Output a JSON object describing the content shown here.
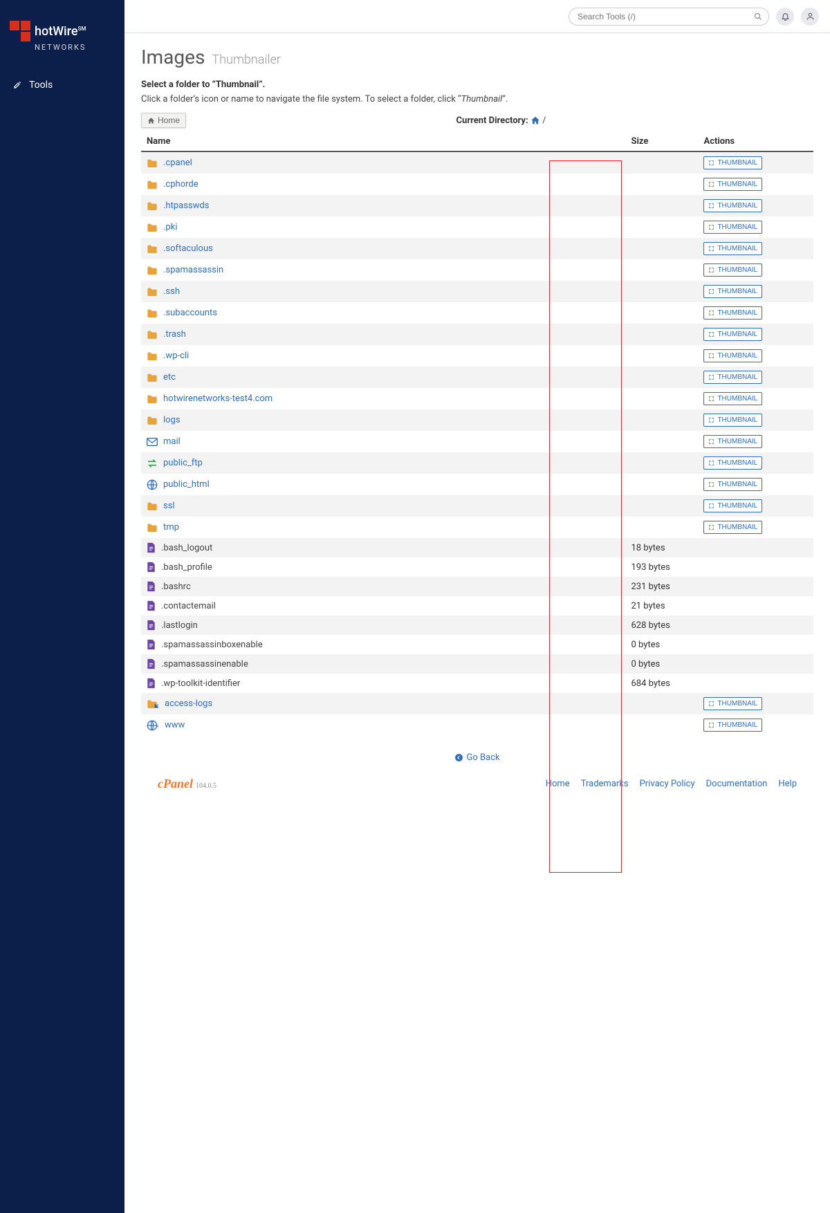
{
  "brand": {
    "name": "hotWire",
    "suffix": "SM",
    "sub": "NETWORKS"
  },
  "sidebar": {
    "tools": "Tools"
  },
  "topbar": {
    "search_placeholder": "Search Tools (/)"
  },
  "page": {
    "title": "Images",
    "subtitle": "Thumbnailer",
    "intro_bold": "Select a folder to “Thumbnail”.",
    "intro_plain_before": "Click a folder’s icon or name to navigate the file system. To select a folder, click “",
    "intro_em": "Thumbnail",
    "intro_plain_after": "”.",
    "home_btn": "Home",
    "cur_dir_label": "Current Directory:",
    "cur_dir_path": "/",
    "go_back": "Go Back"
  },
  "table": {
    "col_name": "Name",
    "col_size": "Size",
    "col_actions": "Actions",
    "thumbnail_label": "THUMBNAIL"
  },
  "rows": [
    {
      "name": ".cpanel",
      "type": "folder"
    },
    {
      "name": ".cphorde",
      "type": "folder"
    },
    {
      "name": ".htpasswds",
      "type": "folder"
    },
    {
      "name": ".pki",
      "type": "folder"
    },
    {
      "name": ".softaculous",
      "type": "folder"
    },
    {
      "name": ".spamassassin",
      "type": "folder"
    },
    {
      "name": ".ssh",
      "type": "folder"
    },
    {
      "name": ".subaccounts",
      "type": "folder"
    },
    {
      "name": ".trash",
      "type": "folder"
    },
    {
      "name": ".wp-cli",
      "type": "folder"
    },
    {
      "name": "etc",
      "type": "folder"
    },
    {
      "name": "hotwirenetworks-test4.com",
      "type": "folder"
    },
    {
      "name": "logs",
      "type": "folder"
    },
    {
      "name": "mail",
      "type": "mail"
    },
    {
      "name": "public_ftp",
      "type": "ftp"
    },
    {
      "name": "public_html",
      "type": "web"
    },
    {
      "name": "ssl",
      "type": "folder"
    },
    {
      "name": "tmp",
      "type": "folder"
    },
    {
      "name": ".bash_logout",
      "type": "file",
      "size": "18 bytes"
    },
    {
      "name": ".bash_profile",
      "type": "file",
      "size": "193 bytes"
    },
    {
      "name": ".bashrc",
      "type": "file",
      "size": "231 bytes"
    },
    {
      "name": ".contactemail",
      "type": "file",
      "size": "21 bytes"
    },
    {
      "name": ".lastlogin",
      "type": "file",
      "size": "628 bytes"
    },
    {
      "name": ".spamassassinboxenable",
      "type": "file",
      "size": "0 bytes"
    },
    {
      "name": ".spamassassinenable",
      "type": "file",
      "size": "0 bytes"
    },
    {
      "name": ".wp-toolkit-identifier",
      "type": "file",
      "size": "684 bytes"
    },
    {
      "name": "access-logs",
      "type": "folder-link"
    },
    {
      "name": "www",
      "type": "web-link"
    }
  ],
  "footer": {
    "cpanel": "cPanel",
    "version": "104.0.5",
    "links": [
      "Home",
      "Trademarks",
      "Privacy Policy",
      "Documentation",
      "Help"
    ]
  }
}
